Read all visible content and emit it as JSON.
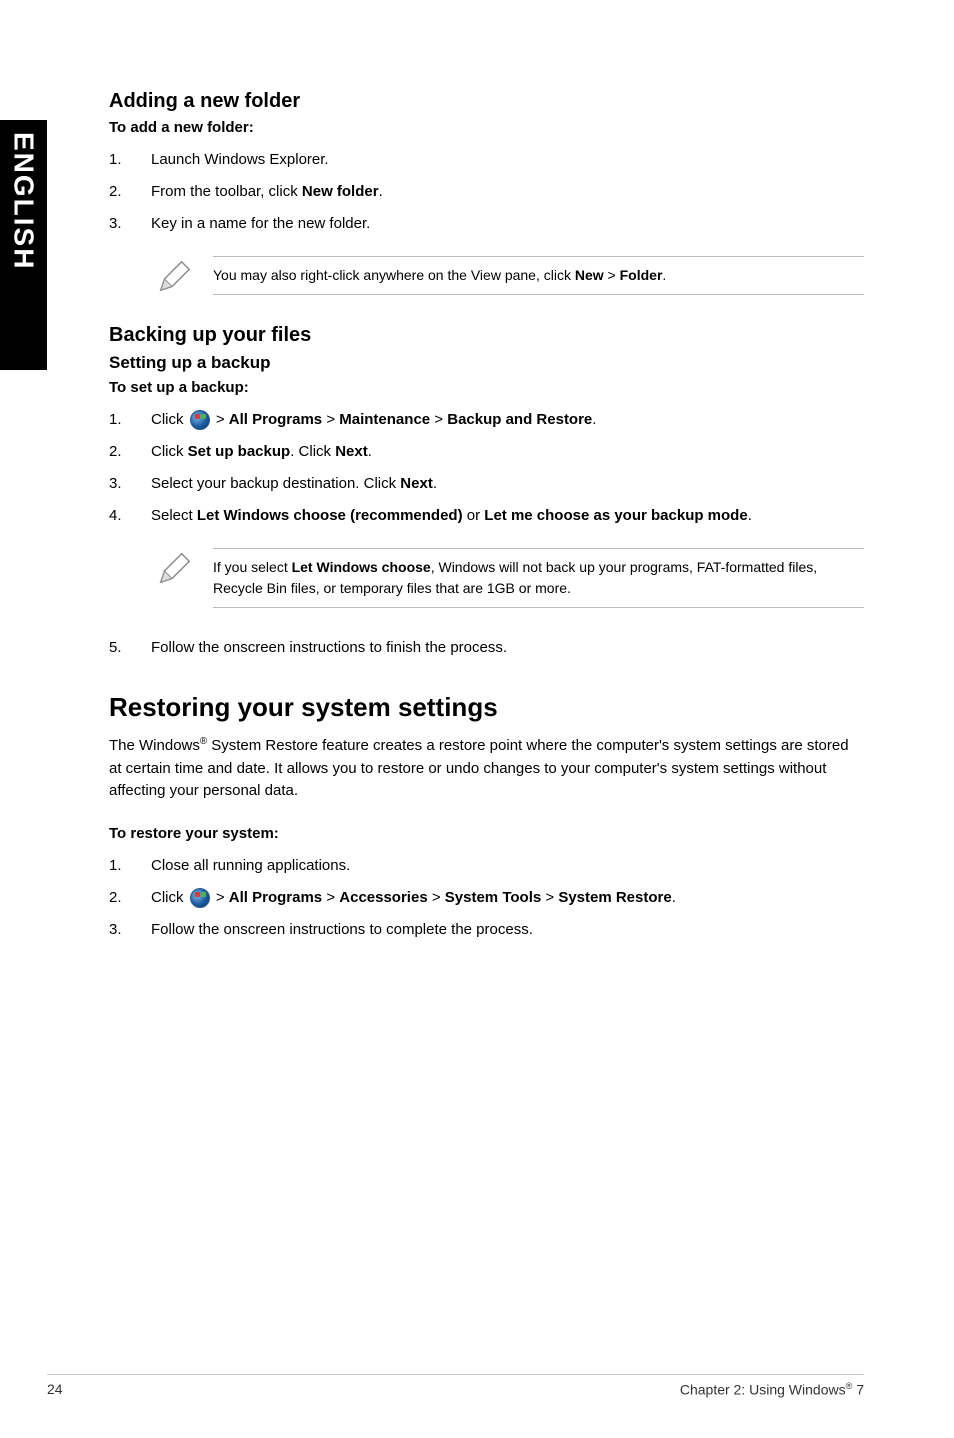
{
  "side_tab": "ENGLISH",
  "section_adding": {
    "heading": "Adding a new folder",
    "subhead": "To add a new folder:",
    "steps": [
      "Launch Windows Explorer.",
      "From the toolbar, click New folder.",
      "Key in a name for the new folder."
    ],
    "step2_prefix": "From the toolbar, click ",
    "step2_bold": "New folder",
    "step2_suffix": ".",
    "note": "You may also right-click anywhere on the View pane, click ",
    "note_bold1": "New",
    "note_mid": " > ",
    "note_bold2": "Folder",
    "note_suffix": "."
  },
  "section_backup": {
    "heading": "Backing up your files",
    "subheading": "Setting up a backup",
    "subhead_bold": "To set up a backup:",
    "step1_prefix": "Click ",
    "step1_after_icon": " > ",
    "step1_b1": "All Programs",
    "step1_s1": " > ",
    "step1_b2": "Maintenance",
    "step1_s2": " > ",
    "step1_b3": "Backup and Restore",
    "step1_suffix": ".",
    "step2_prefix": "Click ",
    "step2_b1": "Set up backup",
    "step2_mid": ". Click ",
    "step2_b2": "Next",
    "step2_suffix": ".",
    "step3_prefix": "Select your backup destination. Click ",
    "step3_b1": "Next",
    "step3_suffix": ".",
    "step4_prefix": "Select ",
    "step4_b1": "Let Windows choose (recommended)",
    "step4_mid": " or ",
    "step4_b2": "Let me choose as your backup mode",
    "step4_suffix": ".",
    "note_prefix": "If you select ",
    "note_bold": "Let Windows choose",
    "note_suffix": ", Windows will not back up your programs, FAT-formatted files, Recycle Bin files, or temporary files that are 1GB or more.",
    "step5": "Follow the onscreen instructions to finish the process."
  },
  "section_restore": {
    "heading": "Restoring your system settings",
    "para_prefix": "The Windows",
    "para_reg": "®",
    "para_suffix": " System Restore feature creates a restore point where the computer's system settings are stored at certain time and date. It allows you to restore or undo changes to your computer's system settings without affecting your personal data.",
    "subhead_bold": "To restore your system:",
    "step1": "Close all running applications.",
    "step2_prefix": "Click ",
    "step2_after_icon": " > ",
    "step2_b1": "All Programs",
    "step2_s1": " > ",
    "step2_b2": "Accessories",
    "step2_s2": " > ",
    "step2_b3": "System Tools",
    "step2_s3": " > ",
    "step2_b4": "System Restore",
    "step2_suffix": ".",
    "step3": "Follow the onscreen instructions to complete the process."
  },
  "footer": {
    "page": "24",
    "chapter_prefix": "Chapter 2: Using Windows",
    "chapter_reg": "®",
    "chapter_suffix": " 7"
  }
}
